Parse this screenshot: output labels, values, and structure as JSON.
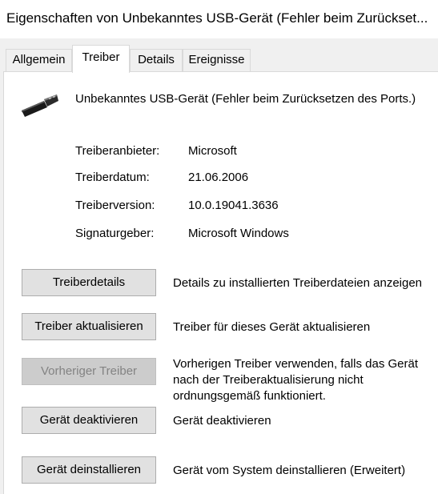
{
  "window": {
    "title": "Eigenschaften von Unbekanntes USB-Gerät (Fehler beim Zurückset..."
  },
  "tabs": [
    {
      "label": "Allgemein",
      "active": false
    },
    {
      "label": "Treiber",
      "active": true
    },
    {
      "label": "Details",
      "active": false
    },
    {
      "label": "Ereignisse",
      "active": false
    }
  ],
  "device": {
    "icon": "usb-plug-icon",
    "name": "Unbekanntes USB-Gerät (Fehler beim Zurücksetzen des Ports.)"
  },
  "driver_info": [
    {
      "label": "Treiberanbieter:",
      "value": "Microsoft"
    },
    {
      "label": "Treiberdatum:",
      "value": "21.06.2006"
    },
    {
      "label": "Treiberversion:",
      "value": "10.0.19041.3636"
    },
    {
      "label": "Signaturgeber:",
      "value": "Microsoft Windows"
    }
  ],
  "actions": [
    {
      "button": "Treiberdetails",
      "description": "Details zu installierten Treiberdateien anzeigen",
      "enabled": true
    },
    {
      "button": "Treiber aktualisieren",
      "description": "Treiber für dieses Gerät aktualisieren",
      "enabled": true
    },
    {
      "button": "Vorheriger Treiber",
      "description": "Vorherigen Treiber verwenden, falls das Gerät nach der Treiberaktualisierung nicht ordnungsgemäß funktioniert.",
      "enabled": false
    },
    {
      "button": "Gerät deaktivieren",
      "description": "Gerät deaktivieren",
      "enabled": true
    },
    {
      "button": "Gerät deinstallieren",
      "description": "Gerät vom System deinstallieren (Erweitert)",
      "enabled": true
    }
  ],
  "colors": {
    "button_bg": "#e1e1e1",
    "button_border": "#adadad",
    "disabled_text": "#838383",
    "panel_bg": "#ffffff",
    "window_bg": "#f0f0f0"
  }
}
